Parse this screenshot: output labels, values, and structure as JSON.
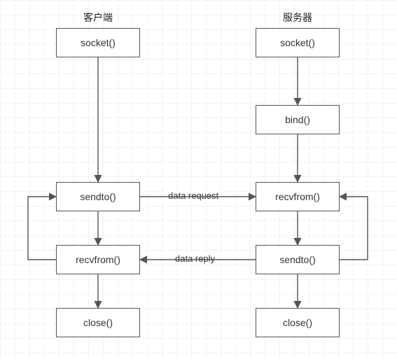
{
  "headers": {
    "client": "客户端",
    "server": "服务器"
  },
  "client": {
    "socket": "socket()",
    "sendto": "sendto()",
    "recvfrom": "recvfrom()",
    "close": "close()"
  },
  "server": {
    "socket": "socket()",
    "bind": "bind()",
    "recvfrom": "recvfrom()",
    "sendto": "sendto()",
    "close": "close()"
  },
  "edges": {
    "request": "data request",
    "reply": "data reply"
  }
}
